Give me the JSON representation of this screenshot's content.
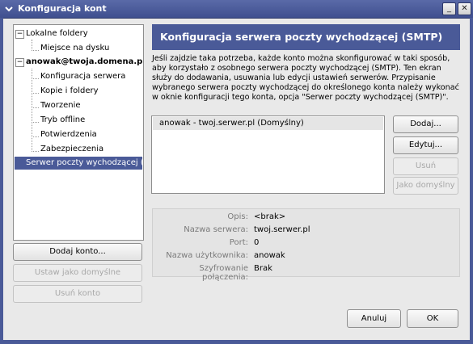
{
  "window": {
    "title": "Konfiguracja kont",
    "menu_icon": "chevron-down-icon",
    "minimize_glyph": "_",
    "close_glyph": "✕"
  },
  "tree": {
    "items": [
      {
        "label": "Lokalne foldery",
        "bold": false,
        "expander": "−"
      },
      {
        "label": "Miejsce na dysku",
        "bold": false
      },
      {
        "label": "anowak@twoja.domena.pl",
        "bold": true,
        "expander": "−"
      },
      {
        "label": "Konfiguracja serwera",
        "bold": false
      },
      {
        "label": "Kopie i foldery",
        "bold": false
      },
      {
        "label": "Tworzenie",
        "bold": false
      },
      {
        "label": "Tryb offline",
        "bold": false
      },
      {
        "label": "Potwierdzenia",
        "bold": false
      },
      {
        "label": "Zabezpieczenia",
        "bold": false
      },
      {
        "label": "Serwer poczty wychodzącej (...",
        "bold": false,
        "selected": true
      }
    ]
  },
  "left_buttons": {
    "add_account": "Dodaj konto...",
    "set_default": "Ustaw jako domyślne",
    "remove_account": "Usuń konto"
  },
  "panel": {
    "header": "Konfiguracja serwera poczty wychodzącej (SMTP)",
    "description": "Jeśli zajdzie taka potrzeba, każde konto można skonfigurować w taki sposób, aby korzystało z osobnego serwera poczty wychodzącej (SMTP). Ten ekran służy do dodawania, usuwania lub edycji ustawień serwerów. Przypisanie wybranego serwera poczty wychodzącej do określonego konta należy wykonać w oknie konfiguracji tego konta, opcja \"Serwer poczty wychodzącej (SMTP)\".",
    "servers": [
      "anowak - twoj.serwer.pl (Domyślny)"
    ],
    "buttons": {
      "add": "Dodaj...",
      "edit": "Edytuj...",
      "remove": "Usuń",
      "set_default": "Jako domyślny"
    },
    "details": [
      {
        "label": "Opis:",
        "value": "<brak>"
      },
      {
        "label": "Nazwa serwera:",
        "value": "twoj.serwer.pl"
      },
      {
        "label": "Port:",
        "value": "0"
      },
      {
        "label": "Nazwa użytkownika:",
        "value": "anowak"
      },
      {
        "label": "Szyfrowanie połączenia:",
        "value": "Brak"
      }
    ]
  },
  "footer": {
    "cancel": "Anuluj",
    "ok": "OK"
  },
  "colors": {
    "accent": "#4a5a98",
    "window_bg": "#e9e9e9"
  }
}
